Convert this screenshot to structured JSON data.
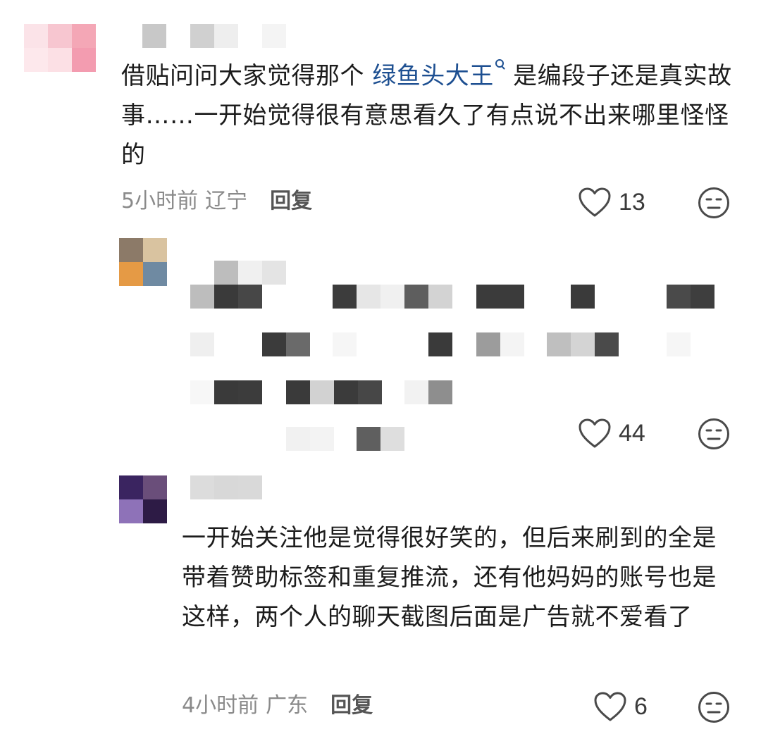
{
  "comments": [
    {
      "text_before": "借贴问问大家觉得那个 ",
      "topic": "绿鱼头大王",
      "text_after": " 是编段子还是真实故事……一开始觉得很有意思看久了有点说不出来哪里怪怪的",
      "time": "5小时前",
      "location": "辽宁",
      "reply_label": "回复",
      "likes": "13"
    },
    {
      "likes": "44"
    },
    {
      "text": "一开始关注他是觉得很好笑的，但后来刷到的全是带着赞助标签和重复推流，还有他妈妈的账号也是这样，两个人的聊天截图后面是广告就不爱看了",
      "time": "4小时前",
      "location": "广东",
      "reply_label": "回复",
      "likes": "6"
    }
  ],
  "colors": {
    "text": "#1c1c1c",
    "topic_link": "#1d4f91",
    "meta": "#8a8a8a",
    "icon": "#4a4a4a"
  },
  "icons": {
    "like": "heart-outline-icon",
    "reaction": "neutral-face-icon",
    "topic": "search-icon"
  }
}
